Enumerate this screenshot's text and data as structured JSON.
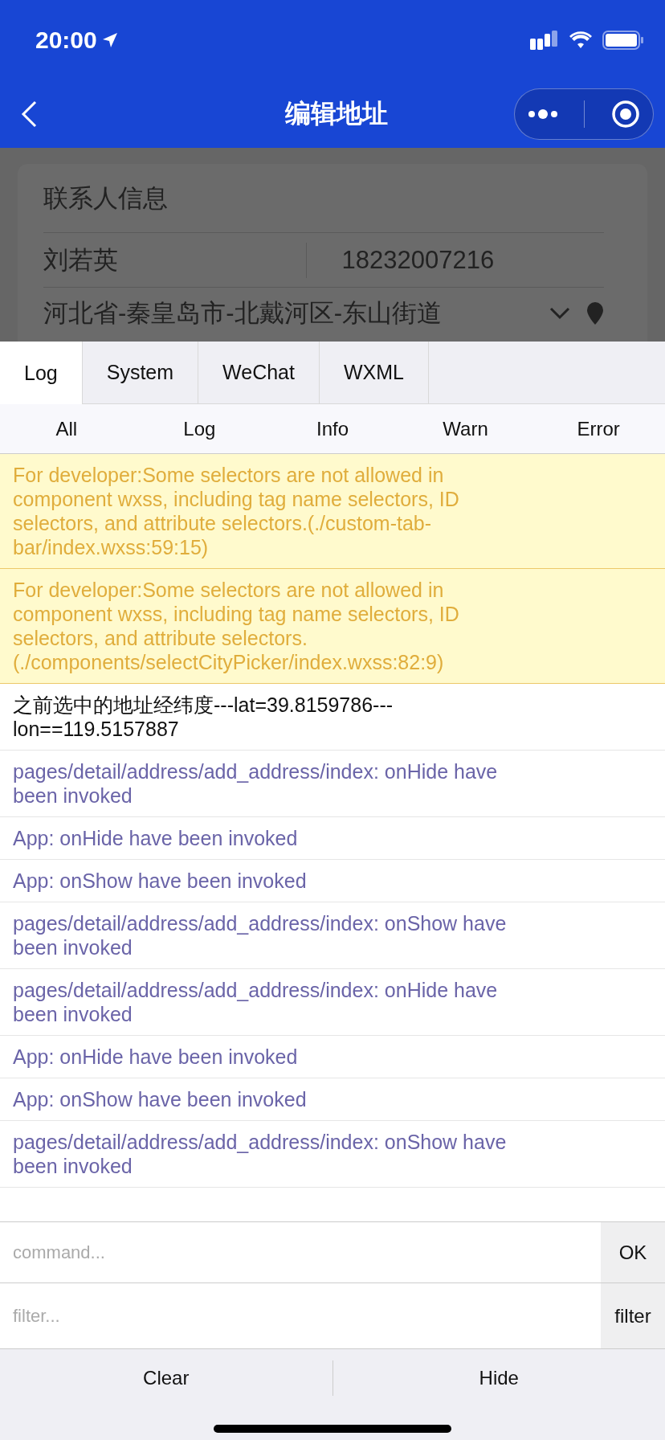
{
  "status_bar": {
    "time": "20:00"
  },
  "nav": {
    "title": "编辑地址"
  },
  "form": {
    "section_title": "联系人信息",
    "name": "刘若英",
    "phone": "18232007216",
    "address": "河北省-秦皇岛市-北戴河区-东山街道"
  },
  "tabs": [
    {
      "label": "Log",
      "selected": true
    },
    {
      "label": "System",
      "selected": false
    },
    {
      "label": "WeChat",
      "selected": false
    },
    {
      "label": "WXML",
      "selected": false
    }
  ],
  "filters": [
    {
      "label": "All",
      "selected": false
    },
    {
      "label": "Log",
      "selected": false
    },
    {
      "label": "Info",
      "selected": false
    },
    {
      "label": "Warn",
      "selected": false
    },
    {
      "label": "Error",
      "selected": false
    }
  ],
  "logs": [
    {
      "kind": "warn",
      "text": "For developer:Some selectors are not allowed in component wxss, including tag name selectors, ID selectors, and attribute selectors.(./custom-tab-bar/index.wxss:59:15)"
    },
    {
      "kind": "warn",
      "text": "For developer:Some selectors are not allowed in component wxss, including tag name selectors, ID selectors, and attribute selectors. (./components/selectCityPicker/index.wxss:82:9)"
    },
    {
      "kind": "log",
      "text": "之前选中的地址经纬度---lat=39.8159786---lon==119.5157887"
    },
    {
      "kind": "system",
      "text": "pages/detail/address/add_address/index: onHide have been invoked"
    },
    {
      "kind": "system",
      "text": "App: onHide have been invoked"
    },
    {
      "kind": "system",
      "text": "App: onShow have been invoked"
    },
    {
      "kind": "system",
      "text": "pages/detail/address/add_address/index: onShow have been invoked"
    },
    {
      "kind": "system",
      "text": "pages/detail/address/add_address/index: onHide have been invoked"
    },
    {
      "kind": "system",
      "text": "App: onHide have been invoked"
    },
    {
      "kind": "system",
      "text": "App: onShow have been invoked"
    },
    {
      "kind": "system",
      "text": "pages/detail/address/add_address/index: onShow have been invoked"
    }
  ],
  "command": {
    "placeholder": "command...",
    "button": "OK"
  },
  "filter": {
    "placeholder": "filter...",
    "button": "filter"
  },
  "buttons": [
    "Clear",
    "Hide"
  ]
}
